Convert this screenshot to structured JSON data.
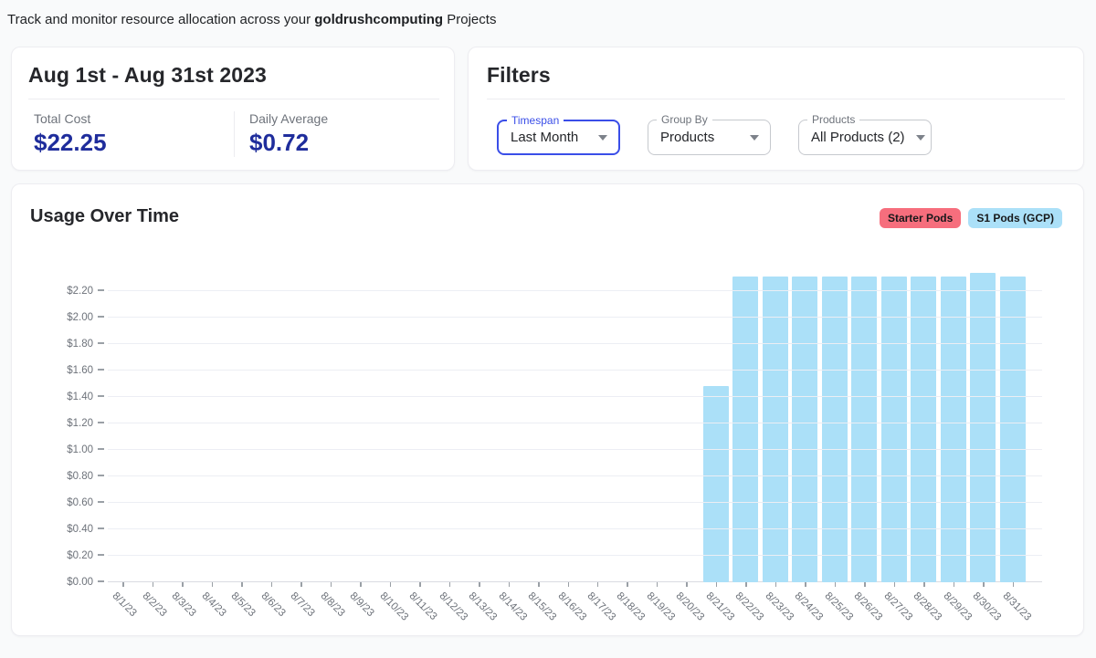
{
  "header": {
    "prefix": "Track and monitor resource allocation across your ",
    "highlight": "goldrushcomputing",
    "suffix": " Projects"
  },
  "summary": {
    "title": "Aug 1st - Aug 31st 2023",
    "stats": [
      {
        "label": "Total Cost",
        "value": "$22.25"
      },
      {
        "label": "Daily Average",
        "value": "$0.72"
      }
    ]
  },
  "filters": {
    "title": "Filters",
    "fields": [
      {
        "label": "Timespan",
        "value": "Last Month",
        "focused": true
      },
      {
        "label": "Group By",
        "value": "Products",
        "focused": false
      },
      {
        "label": "Products",
        "value": "All Products (2)",
        "focused": false
      }
    ]
  },
  "colors": {
    "accent_blue": "#3a4ee8",
    "value_navy": "#1f2d9c",
    "starter_pods": "#f66e7d",
    "s1_pods_badge": "#a8dcf7",
    "bar_blue": "#abe0f8"
  },
  "chart_data": {
    "type": "bar",
    "title": "Usage Over Time",
    "categories": [
      "8/1/23",
      "8/2/23",
      "8/3/23",
      "8/4/23",
      "8/5/23",
      "8/6/23",
      "8/7/23",
      "8/8/23",
      "8/9/23",
      "8/10/23",
      "8/11/23",
      "8/12/23",
      "8/13/23",
      "8/14/23",
      "8/15/23",
      "8/16/23",
      "8/17/23",
      "8/18/23",
      "8/19/23",
      "8/20/23",
      "8/21/23",
      "8/22/23",
      "8/23/23",
      "8/24/23",
      "8/25/23",
      "8/26/23",
      "8/27/23",
      "8/28/23",
      "8/29/23",
      "8/30/23",
      "8/31/23"
    ],
    "series": [
      {
        "name": "Starter Pods",
        "color": "#f66e7d",
        "values": [
          0,
          0,
          0,
          0,
          0,
          0,
          0,
          0,
          0,
          0,
          0,
          0,
          0,
          0,
          0,
          0,
          0,
          0,
          0,
          0,
          0,
          0,
          0,
          0,
          0,
          0,
          0,
          0,
          0,
          0,
          0
        ]
      },
      {
        "name": "S1 Pods (GCP)",
        "color": "#abe0f8",
        "values": [
          0,
          0,
          0,
          0,
          0,
          0,
          0,
          0,
          0,
          0,
          0,
          0,
          0,
          0,
          0,
          0,
          0,
          0,
          0,
          0,
          1.48,
          2.31,
          2.31,
          2.31,
          2.31,
          2.31,
          2.31,
          2.31,
          2.31,
          2.34,
          2.31
        ]
      }
    ],
    "xlabel": "",
    "ylabel": "",
    "y_min": 0,
    "y_max": 2.2,
    "y_step": 0.2,
    "y_tick_format": "$0.00",
    "grid": true,
    "legend_position": "top-right",
    "x_label_rotation": 45
  }
}
